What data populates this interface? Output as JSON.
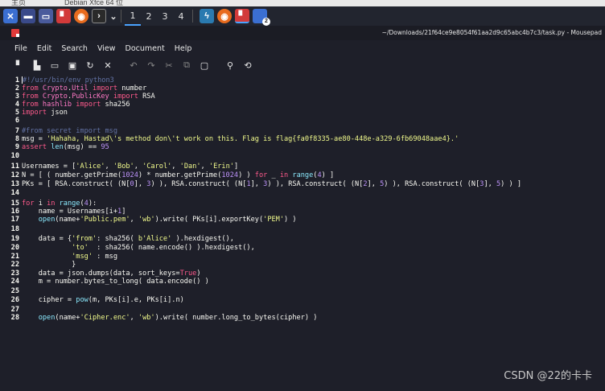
{
  "topstrip": {
    "tab1": "主页",
    "tab2": "Debian Xfce 64 位"
  },
  "taskbar": {
    "workspaces": [
      "1",
      "2",
      "3",
      "4"
    ],
    "badge": "2"
  },
  "window": {
    "title": "~/Downloads/21f64ce9e8054f61aa2d9c65abc4b7c3/task.py - Mousepad"
  },
  "menu": [
    "File",
    "Edit",
    "Search",
    "View",
    "Document",
    "Help"
  ],
  "toolbar": {
    "new": "new-doc-icon",
    "open": "open-icon",
    "save": "save-icon",
    "saveas": "save-as-icon",
    "reload": "reload-icon",
    "close": "close-icon",
    "undo": "undo-icon",
    "redo": "redo-icon",
    "cut": "cut-icon",
    "copy": "copy-icon",
    "paste": "paste-icon",
    "find": "search-icon",
    "replace": "find-replace-icon"
  },
  "code": [
    {
      "n": "1",
      "t": "#!/usr/bin/env python3"
    },
    {
      "n": "2",
      "t": "from Crypto.Util import number"
    },
    {
      "n": "3",
      "t": "from Crypto.PublicKey import RSA"
    },
    {
      "n": "4",
      "t": "from hashlib import sha256"
    },
    {
      "n": "5",
      "t": "import json"
    },
    {
      "n": "6",
      "t": ""
    },
    {
      "n": "7",
      "t": "#from secret import msg"
    },
    {
      "n": "8",
      "t": "msg = 'Hahaha, Hastad\\'s method don\\'t work on this. Flag is flag{fa0f8335-ae80-448e-a329-6fb69048aae4}.'"
    },
    {
      "n": "9",
      "t": "assert len(msg) == 95"
    },
    {
      "n": "10",
      "t": ""
    },
    {
      "n": "11",
      "t": "Usernames = ['Alice', 'Bob', 'Carol', 'Dan', 'Erin']"
    },
    {
      "n": "12",
      "t": "N = [ ( number.getPrime(1024) * number.getPrime(1024) ) for _ in range(4) ]"
    },
    {
      "n": "13",
      "t": "PKs = [ RSA.construct( (N[0], 3) ), RSA.construct( (N[1], 3) ), RSA.construct( (N[2], 5) ), RSA.construct( (N[3], 5) ) ]"
    },
    {
      "n": "14",
      "t": ""
    },
    {
      "n": "15",
      "t": "for i in range(4):"
    },
    {
      "n": "16",
      "t": "    name = Usernames[i+1]"
    },
    {
      "n": "17",
      "t": "    open(name+'Public.pem', 'wb').write( PKs[i].exportKey('PEM') )"
    },
    {
      "n": "18",
      "t": ""
    },
    {
      "n": "19",
      "t": "    data = {'from': sha256( b'Alice' ).hexdigest(),"
    },
    {
      "n": "20",
      "t": "            'to'  : sha256( name.encode() ).hexdigest(),"
    },
    {
      "n": "21",
      "t": "            'msg' : msg"
    },
    {
      "n": "22",
      "t": "            }"
    },
    {
      "n": "23",
      "t": "    data = json.dumps(data, sort_keys=True)"
    },
    {
      "n": "24",
      "t": "    m = number.bytes_to_long( data.encode() )"
    },
    {
      "n": "25",
      "t": ""
    },
    {
      "n": "26",
      "t": "    cipher = pow(m, PKs[i].e, PKs[i].n)"
    },
    {
      "n": "27",
      "t": ""
    },
    {
      "n": "28",
      "t": "    open(name+'Cipher.enc', 'wb').write( number.long_to_bytes(cipher) )"
    }
  ],
  "watermark": "CSDN @22的卡卡",
  "colors": {
    "bg": "#1e1f29",
    "keyword": "#ff5a8c",
    "comment": "#6272a4",
    "string": "#f1fa8c",
    "number": "#bd93f9",
    "function": "#8be9fd"
  }
}
